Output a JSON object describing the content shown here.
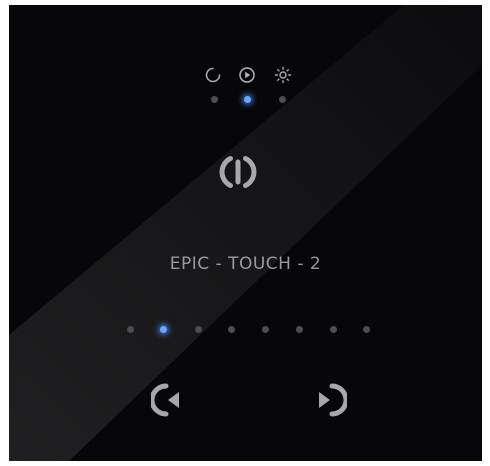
{
  "device": {
    "name": "EPIC - TOUCH - 2"
  },
  "modes": {
    "items": [
      {
        "icon": "refresh-icon",
        "active": false
      },
      {
        "icon": "play-icon",
        "active": true
      },
      {
        "icon": "brightness-icon",
        "active": false
      }
    ],
    "active_index": 1
  },
  "pager": {
    "count": 8,
    "active_index": 1
  },
  "colors": {
    "panel_background": "#070709",
    "icon_gray": "#a8a8ab",
    "indicator_inactive": "#4d4d52",
    "indicator_active": "#6aa6ff"
  }
}
